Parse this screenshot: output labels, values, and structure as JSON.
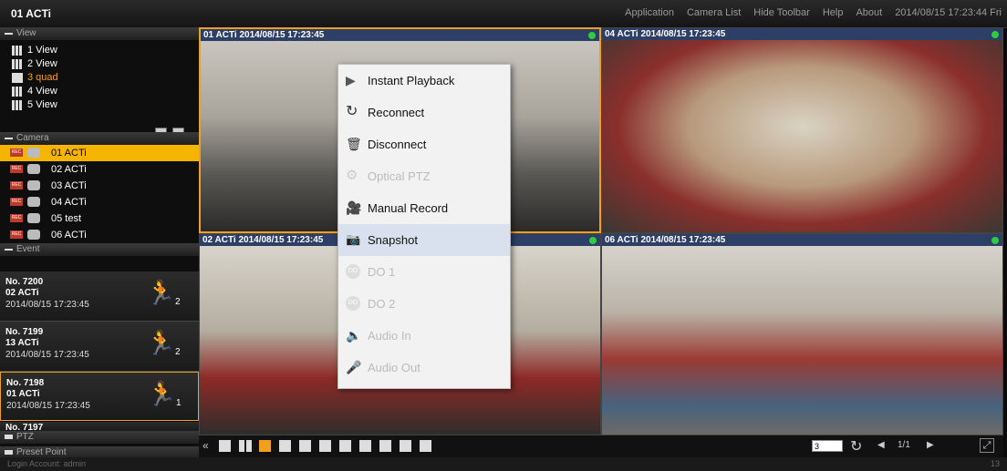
{
  "app_title": "01 ACTi",
  "menu": [
    "Application",
    "Camera List",
    "Hide Toolbar",
    "Help",
    "About"
  ],
  "clock": "2014/08/15 17:23:44 Fri",
  "sidebar": {
    "view_header": "View",
    "views": [
      "1 View",
      "2 View",
      "3 quad",
      "4 View",
      "5 View"
    ],
    "camera_header": "Camera",
    "cameras": [
      "01  ACTi",
      "02  ACTi",
      "03  ACTi",
      "04  ACTi",
      "05  test",
      "06  ACTi"
    ],
    "event_header": "Event",
    "events": [
      {
        "no": "No. 7200",
        "cam": "02 ACTi",
        "time": "2014/08/15 17:23:45",
        "count": "2"
      },
      {
        "no": "No. 7199",
        "cam": "13 ACTi",
        "time": "2014/08/15 17:23:45",
        "count": "2"
      },
      {
        "no": "No. 7198",
        "cam": "01 ACTi",
        "time": "2014/08/15 17:23:45",
        "count": "1"
      },
      {
        "no": "No. 7197",
        "cam": "",
        "time": "",
        "count": ""
      }
    ],
    "ptz_header": "PTZ",
    "preset_header": "Preset Point"
  },
  "tiles": [
    {
      "title": "01 ACTi   2014/08/15 17:23:45"
    },
    {
      "title": "04 ACTi   2014/08/15 17:23:45"
    },
    {
      "title": "02 ACTi   2014/08/15 17:23:45"
    },
    {
      "title": "06 ACTi   2014/08/15 17:23:45"
    }
  ],
  "context_menu": [
    "Instant Playback",
    "Reconnect",
    "Disconnect",
    "Optical PTZ",
    "Manual Record",
    "Snapshot",
    "DO 1",
    "DO 2",
    "Audio In",
    "Audio Out"
  ],
  "bottom": {
    "page_input": "3",
    "page": "1/1"
  },
  "status": {
    "login": "Login Account: admin",
    "count": "13"
  },
  "colors": {
    "accent": "#f0a020",
    "title_bar": "#2d3f66"
  }
}
